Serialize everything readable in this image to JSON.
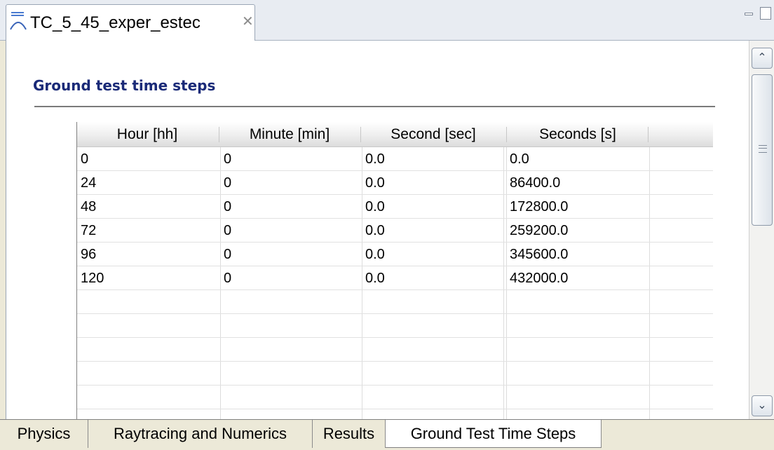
{
  "editor": {
    "title": "TC_5_45_exper_estec",
    "close_glyph": "✕",
    "icon": "thermal-model-icon"
  },
  "window_controls": {
    "minimize_icon": "minimize-icon",
    "maximize_icon": "maximize-icon"
  },
  "section": {
    "title": "Ground test time steps"
  },
  "table": {
    "columns": [
      "Hour [hh]",
      "Minute [min]",
      "Second [sec]",
      "Seconds [s]"
    ],
    "rows": [
      [
        "0",
        "0",
        "0.0",
        "0.0"
      ],
      [
        "24",
        "0",
        "0.0",
        "86400.0"
      ],
      [
        "48",
        "0",
        "0.0",
        "172800.0"
      ],
      [
        "72",
        "0",
        "0.0",
        "259200.0"
      ],
      [
        "96",
        "0",
        "0.0",
        "345600.0"
      ],
      [
        "120",
        "0",
        "0.0",
        "432000.0"
      ]
    ]
  },
  "scrollbar": {
    "up_glyph": "⌃",
    "down_glyph": "⌄"
  },
  "bottom_tabs": [
    {
      "label": "Physics",
      "active": false
    },
    {
      "label": "Raytracing and Numerics",
      "active": false
    },
    {
      "label": "Results",
      "active": false
    },
    {
      "label": "Ground Test Time Steps",
      "active": true
    }
  ]
}
